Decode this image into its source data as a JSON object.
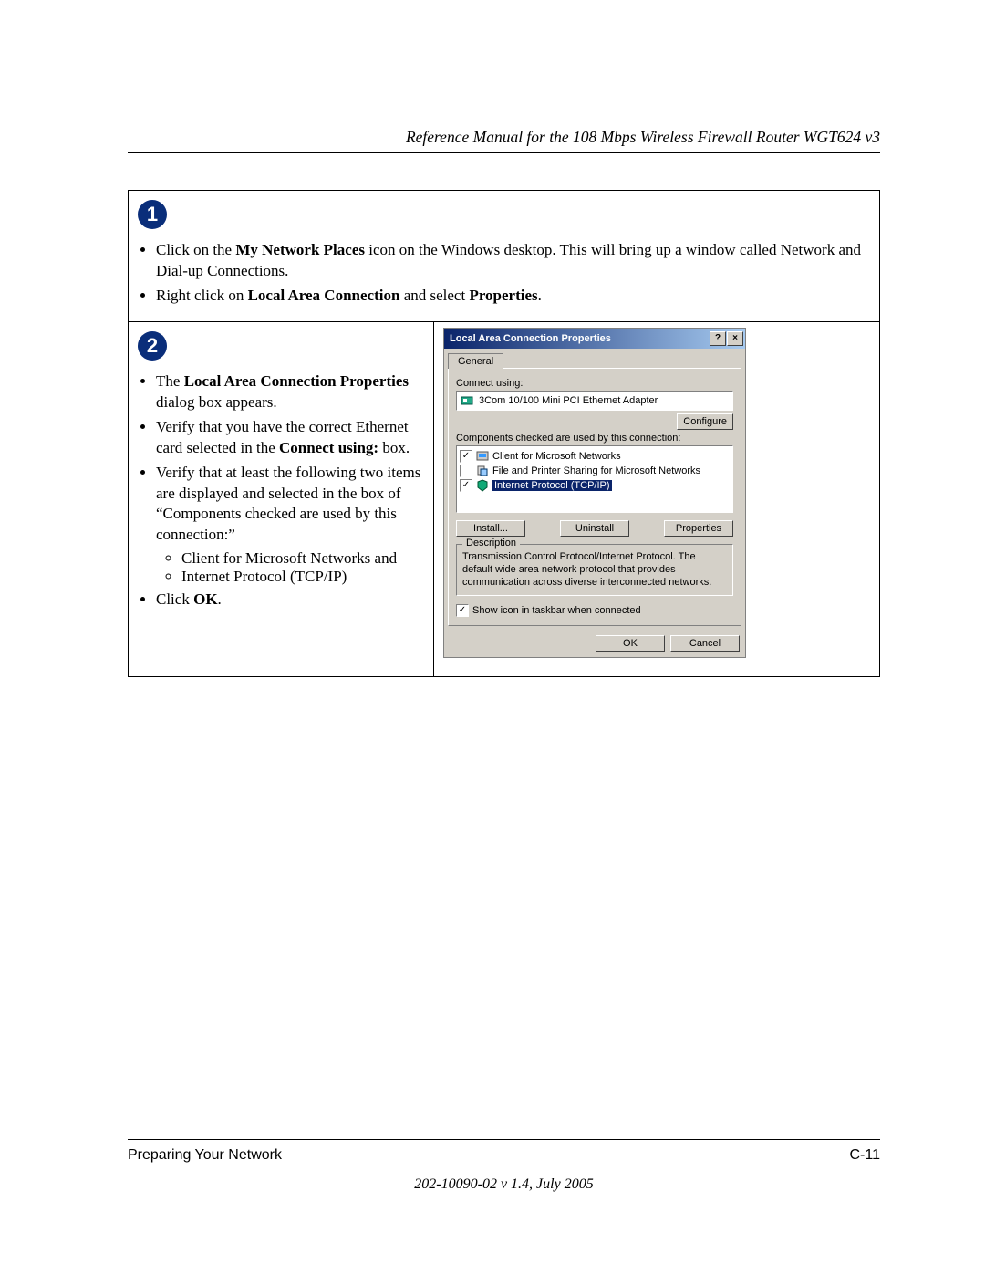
{
  "header": {
    "title": "Reference Manual for the 108 Mbps Wireless Firewall Router WGT624 v3"
  },
  "step1": {
    "badge": "1",
    "bullet1_prefix": "Click on the ",
    "bullet1_bold": "My Network Places",
    "bullet1_suffix": " icon on the Windows desktop.  This will bring up a window called Network and Dial-up Connections.",
    "bullet2_prefix": "Right click on ",
    "bullet2_bold1": "Local Area Connection",
    "bullet2_mid": " and select ",
    "bullet2_bold2": "Properties",
    "bullet2_suffix": "."
  },
  "step2": {
    "badge": "2",
    "b1_prefix": "The ",
    "b1_bold": "Local Area Connection Properties",
    "b1_suffix": " dialog box appears.",
    "b2_prefix": "Verify that you have the correct Ethernet card selected in the ",
    "b2_bold": "Connect using:",
    "b2_suffix": " box.",
    "b3": "Verify that at least the following two items are displayed and selected in the box of “Components checked are used by this connection:”",
    "sub1": "Client for Microsoft Networks and",
    "sub2": "Internet Protocol (TCP/IP)",
    "b4_prefix": "Click ",
    "b4_bold": "OK",
    "b4_suffix": "."
  },
  "dialog": {
    "title": "Local Area Connection Properties",
    "help_btn": "?",
    "close_btn": "×",
    "tab": "General",
    "connect_using_label": "Connect using:",
    "adapter": "3Com 10/100 Mini PCI Ethernet Adapter",
    "configure_btn": "Configure",
    "components_label": "Components checked are used by this connection:",
    "item1": "Client for Microsoft Networks",
    "item2": "File and Printer Sharing for Microsoft Networks",
    "item3": "Internet Protocol (TCP/IP)",
    "install_btn": "Install...",
    "uninstall_btn": "Uninstall",
    "properties_btn": "Properties",
    "desc_label": "Description",
    "desc_text": "Transmission Control Protocol/Internet Protocol. The default wide area network protocol that provides communication across diverse interconnected networks.",
    "show_icon": "Show icon in taskbar when connected",
    "ok_btn": "OK",
    "cancel_btn": "Cancel"
  },
  "footer": {
    "section": "Preparing Your Network",
    "pagenum": "C-11",
    "docver": "202-10090-02 v 1.4, July 2005"
  }
}
